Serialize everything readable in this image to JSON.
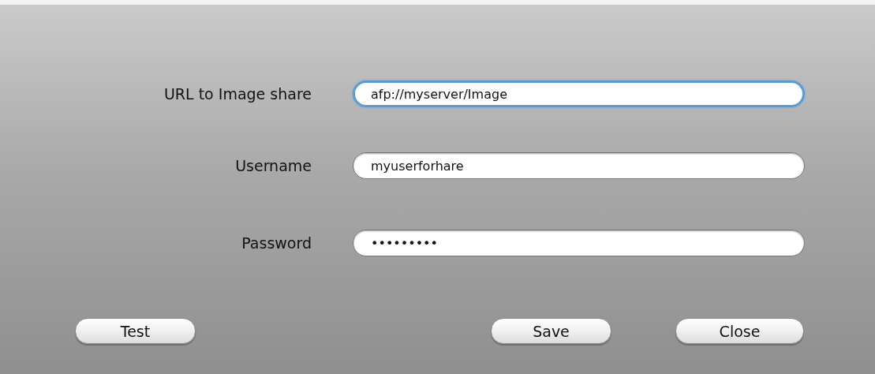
{
  "fields": [
    {
      "label": "URL to Image share",
      "value": "afp://myserver/Image",
      "focused": true
    },
    {
      "label": "Username",
      "value": "myuserforhare",
      "focused": false
    },
    {
      "label": "Password",
      "value": "•••••••••",
      "focused": false
    }
  ],
  "buttons": [
    "Test",
    "Save",
    "Close"
  ]
}
